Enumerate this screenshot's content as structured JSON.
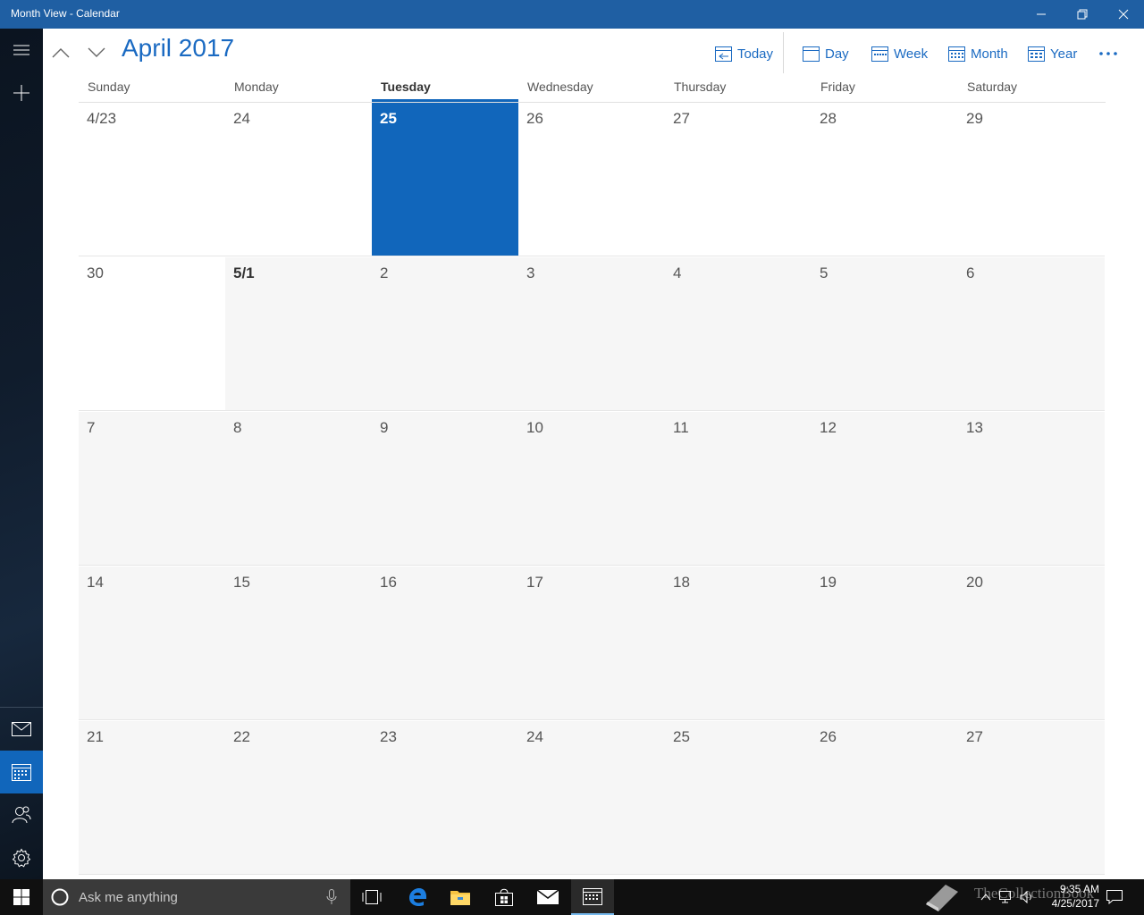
{
  "window": {
    "title": "Month View - Calendar"
  },
  "header": {
    "month_title": "April 2017",
    "commands": {
      "today": "Today",
      "day": "Day",
      "week": "Week",
      "month": "Month",
      "year": "Year"
    }
  },
  "weekdays": [
    "Sunday",
    "Monday",
    "Tuesday",
    "Wednesday",
    "Thursday",
    "Friday",
    "Saturday"
  ],
  "today_weekday_index": 2,
  "weeks": [
    [
      "4/23",
      "24",
      "25",
      "26",
      "27",
      "28",
      "29"
    ],
    [
      "30",
      "5/1",
      "2",
      "3",
      "4",
      "5",
      "6"
    ],
    [
      "7",
      "8",
      "9",
      "10",
      "11",
      "12",
      "13"
    ],
    [
      "14",
      "15",
      "16",
      "17",
      "18",
      "19",
      "20"
    ],
    [
      "21",
      "22",
      "23",
      "24",
      "25",
      "26",
      "27"
    ]
  ],
  "selected_date": "25",
  "taskbar": {
    "search_placeholder": "Ask me anything",
    "clock_time": "9:35 AM",
    "clock_date": "4/25/2017",
    "watermark": "TheCollectionBook"
  },
  "colors": {
    "accent": "#1166bb",
    "titlebar": "#1f5fa3",
    "month_title": "#1a6ac2",
    "current_month_cell": "#ffffff",
    "other_month_cell": "#f6f6f6"
  }
}
